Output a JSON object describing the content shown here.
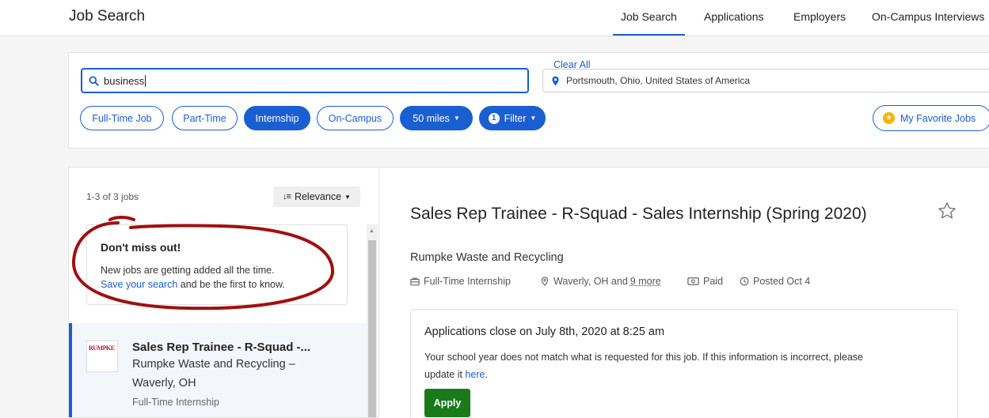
{
  "header": {
    "title": "Job Search",
    "tabs": [
      {
        "label": "Job Search",
        "active": true
      },
      {
        "label": "Applications"
      },
      {
        "label": "Employers"
      },
      {
        "label": "On-Campus Interviews"
      }
    ]
  },
  "search": {
    "keyword_value": "business",
    "location_value": "Portsmouth, Ohio, United States of America",
    "filters": [
      {
        "label": "Full-Time Job"
      },
      {
        "label": "Part-Time"
      },
      {
        "label": "Internship",
        "selected": true
      },
      {
        "label": "On-Campus"
      },
      {
        "label": "50 miles",
        "selected": true
      },
      {
        "label": "Filter",
        "badge": "1",
        "selected": true
      }
    ],
    "clear_all": "Clear All",
    "favorites": "My Favorite Jobs"
  },
  "results": {
    "count": "1-3 of 3 jobs",
    "sort_label": "Relevance",
    "promo": {
      "heading": "Don't miss out!",
      "line1": "New jobs are getting added all the time.",
      "link": "Save your search",
      "line2_rest": " and be the first to know."
    },
    "jobs": [
      {
        "logo_text": "RUMPKE",
        "title": "Sales Rep Trainee - R-Squad -...",
        "company": "Rumpke Waste and Recycling –",
        "location": "Waverly, OH",
        "type": "Full-Time Internship"
      }
    ]
  },
  "detail": {
    "title": "Sales Rep Trainee - R-Squad - Sales Internship (Spring 2020)",
    "company": "Rumpke Waste and Recycling",
    "meta": {
      "type": "Full-Time Internship",
      "location": "Waverly, OH and",
      "more": "9 more",
      "paid": "Paid",
      "posted": "Posted Oct 4"
    },
    "apply_box": {
      "closes": "Applications close on July 8th, 2020 at 8:25 am",
      "message_line1": "Your school year does not match what is requested for this job. If this information is incorrect, please",
      "message_line2_pre": "update it ",
      "message_link": "here",
      "message_line2_post": ".",
      "apply_label": "Apply"
    }
  },
  "colors": {
    "accent": "#1a5fd1",
    "apply_green": "#1a7a1a",
    "annotation_red": "#a01010",
    "favorite_star": "#f5b400"
  }
}
